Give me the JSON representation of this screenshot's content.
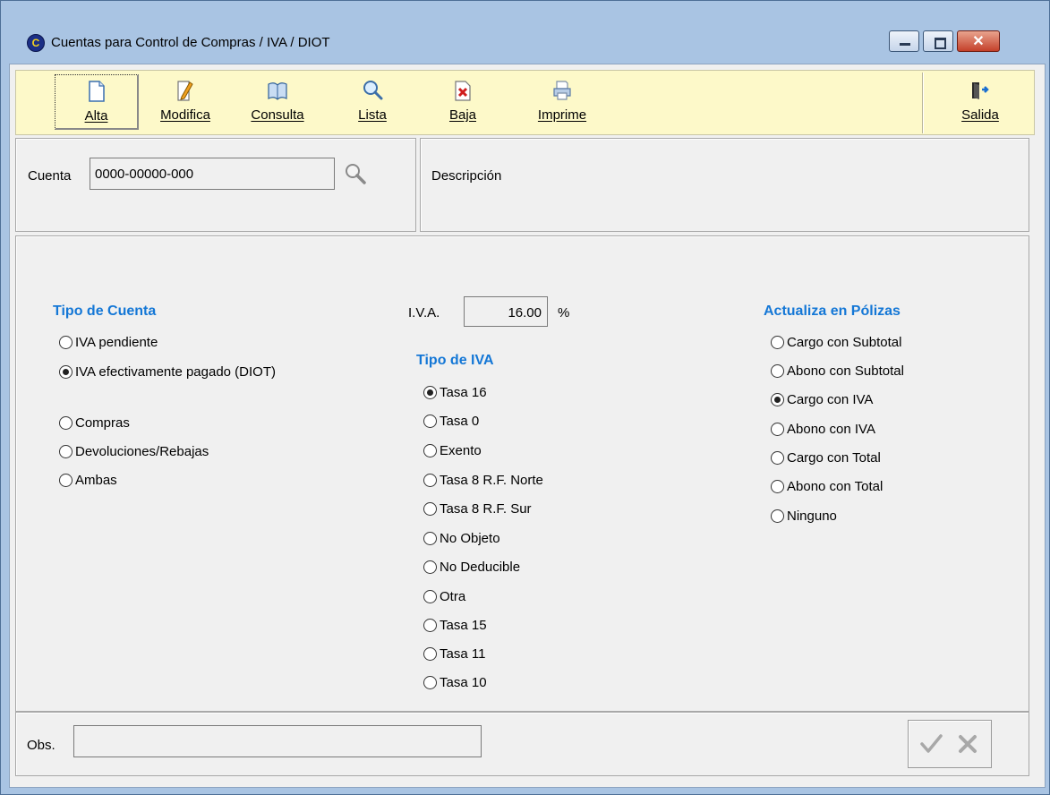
{
  "window": {
    "title": "Cuentas para Control de Compras / IVA / DIOT",
    "app_icon_letter": "C"
  },
  "toolbar": {
    "buttons": [
      {
        "label": "Alta",
        "icon": "new-document-icon"
      },
      {
        "label": "Modifica",
        "icon": "edit-icon"
      },
      {
        "label": "Consulta",
        "icon": "book-icon"
      },
      {
        "label": "Lista",
        "icon": "magnifier-icon"
      },
      {
        "label": "Baja",
        "icon": "delete-document-icon"
      },
      {
        "label": "Imprime",
        "icon": "printer-icon"
      }
    ],
    "exit_label": "Salida"
  },
  "cuenta": {
    "label": "Cuenta",
    "value": "0000-00000-000"
  },
  "descripcion": {
    "label": "Descripción"
  },
  "tipo_cuenta": {
    "title": "Tipo de Cuenta",
    "options": [
      {
        "label": "IVA pendiente",
        "checked": false
      },
      {
        "label": "IVA efectivamente pagado (DIOT)",
        "checked": true
      }
    ],
    "options2": [
      {
        "label": "Compras",
        "checked": false
      },
      {
        "label": "Devoluciones/Rebajas",
        "checked": false
      },
      {
        "label": "Ambas",
        "checked": false
      }
    ]
  },
  "iva": {
    "label": "I.V.A.",
    "value": "16.00",
    "unit": "%"
  },
  "tipo_iva": {
    "title": "Tipo de IVA",
    "options": [
      {
        "label": "Tasa 16",
        "checked": true
      },
      {
        "label": "Tasa 0",
        "checked": false
      },
      {
        "label": "Exento",
        "checked": false
      },
      {
        "label": "Tasa 8 R.F. Norte",
        "checked": false
      },
      {
        "label": "Tasa 8 R.F. Sur",
        "checked": false
      },
      {
        "label": "No Objeto",
        "checked": false
      },
      {
        "label": "No Deducible",
        "checked": false
      },
      {
        "label": "Otra",
        "checked": false
      },
      {
        "label": "Tasa 15",
        "checked": false
      },
      {
        "label": "Tasa 11",
        "checked": false
      },
      {
        "label": "Tasa 10",
        "checked": false
      }
    ]
  },
  "polizas": {
    "title": "Actualiza en Pólizas",
    "options": [
      {
        "label": "Cargo con Subtotal",
        "checked": false
      },
      {
        "label": "Abono con Subtotal",
        "checked": false
      },
      {
        "label": "Cargo con IVA",
        "checked": true
      },
      {
        "label": "Abono con IVA",
        "checked": false
      },
      {
        "label": "Cargo con Total",
        "checked": false
      },
      {
        "label": "Abono con Total",
        "checked": false
      },
      {
        "label": "Ninguno",
        "checked": false
      }
    ]
  },
  "obs": {
    "label": "Obs.",
    "value": ""
  }
}
